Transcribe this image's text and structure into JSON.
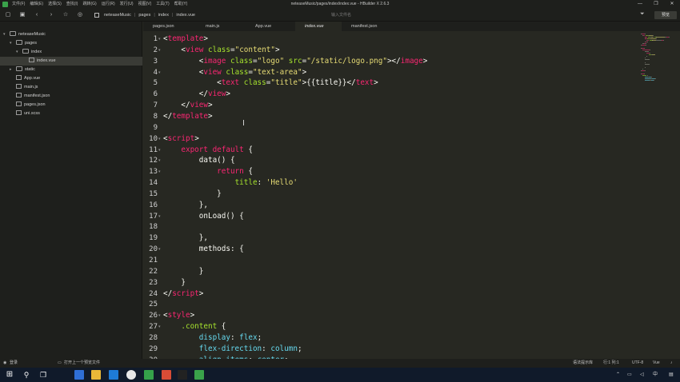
{
  "window": {
    "title": "neteaseMusic/pages/index/index.vue - HBuilder X 2.6.3",
    "menus": [
      "文件(F)",
      "编辑(E)",
      "选择(S)",
      "查找(I)",
      "跳转(G)",
      "运行(R)",
      "发行(U)",
      "视图(V)",
      "工具(T)",
      "帮助(Y)"
    ],
    "controls": [
      "—",
      "❐",
      "✕"
    ]
  },
  "toolbar": {
    "breadcrumbs": [
      "neteaseMusic",
      "pages",
      "index",
      "index.vue"
    ],
    "search_placeholder": "输入文件名",
    "preview_label": "预览"
  },
  "sidebar": {
    "items": [
      {
        "label": "neteaseMusic",
        "type": "project",
        "expanded": true
      },
      {
        "label": "pages",
        "type": "folder",
        "expanded": true
      },
      {
        "label": "index",
        "type": "folder",
        "expanded": true
      },
      {
        "label": "index.vue",
        "type": "file",
        "selected": true
      },
      {
        "label": "static",
        "type": "folder",
        "expanded": false
      },
      {
        "label": "App.vue",
        "type": "file"
      },
      {
        "label": "main.js",
        "type": "file"
      },
      {
        "label": "manifest.json",
        "type": "file"
      },
      {
        "label": "pages.json",
        "type": "file"
      },
      {
        "label": "uni.scss",
        "type": "file"
      }
    ]
  },
  "tabs": [
    {
      "label": "pages.json",
      "active": false
    },
    {
      "label": "main.js",
      "active": false
    },
    {
      "label": "App.vue",
      "active": false
    },
    {
      "label": "index.vue",
      "active": true
    },
    {
      "label": "manifest.json",
      "active": false
    }
  ],
  "code_lines": [
    {
      "n": "1",
      "tokens": [
        [
          "t-p",
          "<"
        ],
        [
          "t-tag",
          "template"
        ],
        [
          "t-p",
          ">"
        ]
      ]
    },
    {
      "n": "2",
      "tokens": [
        [
          "t-p",
          "    <"
        ],
        [
          "t-tag",
          "view"
        ],
        [
          "t-p",
          " "
        ],
        [
          "t-attr",
          "class"
        ],
        [
          "t-p",
          "="
        ],
        [
          "t-str",
          "\"content\""
        ],
        [
          "t-p",
          ">"
        ]
      ]
    },
    {
      "n": "3",
      "tokens": [
        [
          "t-p",
          "        <"
        ],
        [
          "t-tag",
          "image"
        ],
        [
          "t-p",
          " "
        ],
        [
          "t-attr",
          "class"
        ],
        [
          "t-p",
          "="
        ],
        [
          "t-str",
          "\"logo\""
        ],
        [
          "t-p",
          " "
        ],
        [
          "t-attr",
          "src"
        ],
        [
          "t-p",
          "="
        ],
        [
          "t-str",
          "\"/static/logo.png\""
        ],
        [
          "t-p",
          "></"
        ],
        [
          "t-tag",
          "image"
        ],
        [
          "t-p",
          ">"
        ]
      ]
    },
    {
      "n": "4",
      "tokens": [
        [
          "t-p",
          "        <"
        ],
        [
          "t-tag",
          "view"
        ],
        [
          "t-p",
          " "
        ],
        [
          "t-attr",
          "class"
        ],
        [
          "t-p",
          "="
        ],
        [
          "t-str",
          "\"text-area\""
        ],
        [
          "t-p",
          ">"
        ]
      ]
    },
    {
      "n": "5",
      "tokens": [
        [
          "t-p",
          "            <"
        ],
        [
          "t-tag",
          "text"
        ],
        [
          "t-p",
          " "
        ],
        [
          "t-attr",
          "class"
        ],
        [
          "t-p",
          "="
        ],
        [
          "t-str",
          "\"title\""
        ],
        [
          "t-p",
          ">{{title}}</"
        ],
        [
          "t-tag",
          "text"
        ],
        [
          "t-p",
          ">"
        ]
      ]
    },
    {
      "n": "6",
      "tokens": [
        [
          "t-p",
          "        </"
        ],
        [
          "t-tag",
          "view"
        ],
        [
          "t-p",
          ">"
        ]
      ]
    },
    {
      "n": "7",
      "tokens": [
        [
          "t-p",
          "    </"
        ],
        [
          "t-tag",
          "view"
        ],
        [
          "t-p",
          ">"
        ]
      ]
    },
    {
      "n": "8",
      "tokens": [
        [
          "t-p",
          "</"
        ],
        [
          "t-tag",
          "template"
        ],
        [
          "t-p",
          ">"
        ]
      ]
    },
    {
      "n": "9",
      "tokens": []
    },
    {
      "n": "10",
      "tokens": [
        [
          "t-p",
          "<"
        ],
        [
          "t-tag",
          "script"
        ],
        [
          "t-p",
          ">"
        ]
      ]
    },
    {
      "n": "11",
      "tokens": [
        [
          "t-p",
          "    "
        ],
        [
          "t-kw",
          "export default"
        ],
        [
          "t-p",
          " {"
        ]
      ]
    },
    {
      "n": "12",
      "tokens": [
        [
          "t-p",
          "        data() {"
        ]
      ]
    },
    {
      "n": "13",
      "tokens": [
        [
          "t-p",
          "            "
        ],
        [
          "t-kw",
          "return"
        ],
        [
          "t-p",
          " {"
        ]
      ]
    },
    {
      "n": "14",
      "tokens": [
        [
          "t-p",
          "                "
        ],
        [
          "t-attr",
          "title"
        ],
        [
          "t-p",
          ": "
        ],
        [
          "t-str",
          "'Hello'"
        ]
      ]
    },
    {
      "n": "15",
      "tokens": [
        [
          "t-p",
          "            }"
        ]
      ]
    },
    {
      "n": "16",
      "tokens": [
        [
          "t-p",
          "        },"
        ]
      ]
    },
    {
      "n": "17",
      "tokens": [
        [
          "t-p",
          "        onLoad() {"
        ]
      ]
    },
    {
      "n": "18",
      "tokens": []
    },
    {
      "n": "19",
      "tokens": [
        [
          "t-p",
          "        },"
        ]
      ]
    },
    {
      "n": "20",
      "tokens": [
        [
          "t-p",
          "        methods: {"
        ]
      ]
    },
    {
      "n": "21",
      "tokens": []
    },
    {
      "n": "22",
      "tokens": [
        [
          "t-p",
          "        }"
        ]
      ]
    },
    {
      "n": "23",
      "tokens": [
        [
          "t-p",
          "    }"
        ]
      ]
    },
    {
      "n": "24",
      "tokens": [
        [
          "t-p",
          "</"
        ],
        [
          "t-tag",
          "script"
        ],
        [
          "t-p",
          ">"
        ]
      ]
    },
    {
      "n": "25",
      "tokens": []
    },
    {
      "n": "26",
      "tokens": [
        [
          "t-p",
          "<"
        ],
        [
          "t-tag",
          "style"
        ],
        [
          "t-p",
          ">"
        ]
      ]
    },
    {
      "n": "27",
      "tokens": [
        [
          "t-p",
          "    "
        ],
        [
          "t-attr",
          ".content"
        ],
        [
          "t-p",
          " {"
        ]
      ]
    },
    {
      "n": "28",
      "tokens": [
        [
          "t-p",
          "        "
        ],
        [
          "t-key",
          "display"
        ],
        [
          "t-p",
          ": "
        ],
        [
          "t-key",
          "flex"
        ],
        [
          "t-p",
          ";"
        ]
      ]
    },
    {
      "n": "29",
      "tokens": [
        [
          "t-p",
          "        "
        ],
        [
          "t-key",
          "flex-direction"
        ],
        [
          "t-p",
          ": "
        ],
        [
          "t-key",
          "column"
        ],
        [
          "t-p",
          ";"
        ]
      ]
    },
    {
      "n": "30",
      "tokens": [
        [
          "t-p",
          "        "
        ],
        [
          "t-key",
          "align-items"
        ],
        [
          "t-p",
          ": "
        ],
        [
          "t-key",
          "center"
        ],
        [
          "t-p",
          ";"
        ]
      ]
    }
  ],
  "status": {
    "login": "登录",
    "hint": "打开上一个预览文件",
    "syntax_hint": "语法提示库",
    "position": "行:1  列:1",
    "encoding": "UTF-8",
    "language": "Vue"
  },
  "taskbar": {
    "time": "",
    "apps": [
      "windows-start",
      "search",
      "task-view",
      "explorer",
      "file-manager",
      "vscode",
      "hbuilder-green",
      "chrome",
      "hbuilder",
      "terminal",
      "hbuilderx"
    ]
  },
  "colors": {
    "editor_bg": "#272822",
    "sidebar_bg": "#1e1f1c",
    "tag": "#f92672",
    "attr": "#a6e22e",
    "string": "#e6db74",
    "accent_green": "#3aa24a"
  }
}
